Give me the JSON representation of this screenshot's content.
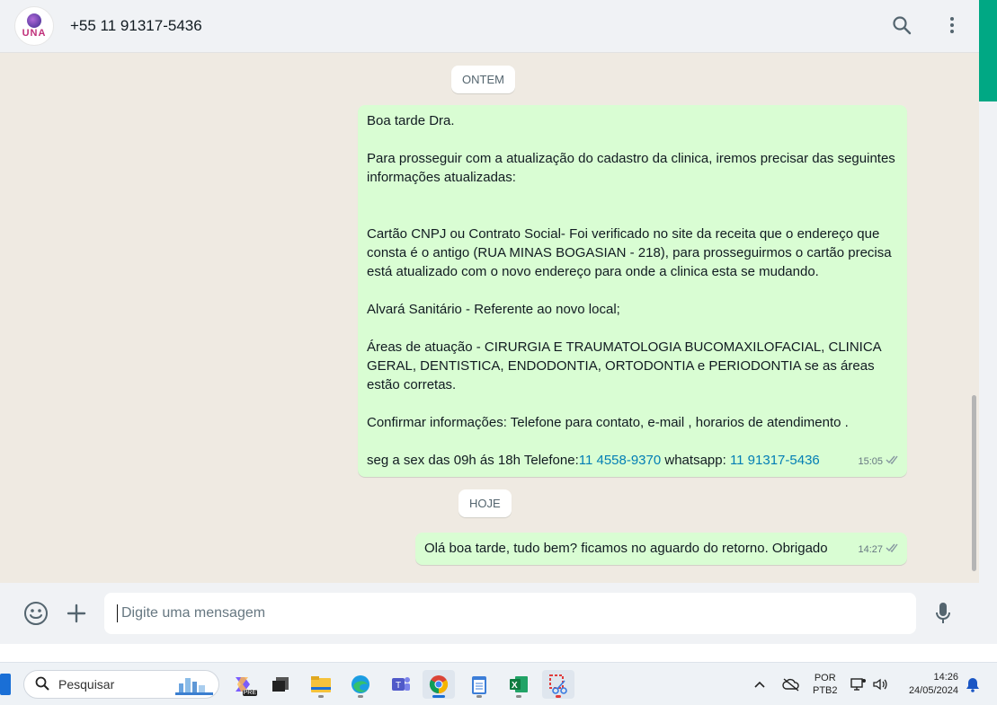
{
  "header": {
    "avatar_text": "UNA",
    "contact": "+55 11 91317-5436",
    "icons": [
      "search-icon",
      "menu-icon"
    ]
  },
  "chat": {
    "day1": "ONTEM",
    "msg1": {
      "p1": "Boa tarde Dra.",
      "p2": "Para prosseguir com a atualização do cadastro da clinica, iremos precisar das seguintes informações atualizadas:",
      "p3": "Cartão CNPJ ou Contrato Social- Foi verificado no site da receita que o endereço que consta é o antigo (RUA MINAS BOGASIAN - 218), para prosseguirmos o cartão precisa está atualizado com o novo endereço para onde a clinica esta se mudando.",
      "p4": "Alvará Sanitário - Referente ao novo local;",
      "p5": "Áreas de atuação - CIRURGIA E TRAUMATOLOGIA BUCOMAXILOFACIAL, CLINICA GERAL, DENTISTICA, ENDODONTIA, ORTODONTIA e PERIODONTIA se as áreas estão corretas.",
      "p6": "Confirmar informações: Telefone para contato, e-mail , horarios de atendimento .",
      "p7_prefix": "seg a sex das 09h ás 18h Telefone:",
      "p7_phone": "11 4558-9370",
      "p7_mid": " whatsapp: ",
      "p7_whatsapp": "11 91317-5436",
      "time": "15:05"
    },
    "day2": "HOJE",
    "msg2": {
      "text": "Olá boa tarde, tudo bem? ficamos no aguardo do retorno. Obrigado",
      "time": "14:27"
    }
  },
  "composer": {
    "placeholder": "Digite uma mensagem",
    "icons": [
      "emoji-icon",
      "plus-icon",
      "mic-icon"
    ]
  },
  "taskbar": {
    "search_label": "Pesquisar",
    "lang_top": "POR",
    "lang_bottom": "PTB2",
    "time": "14:26",
    "date": "24/05/2024",
    "copilot_badge": "PRE"
  },
  "colors": {
    "outgoing_bubble": "#d9fdd3",
    "accent": "#00a884",
    "link": "#027eb5"
  }
}
